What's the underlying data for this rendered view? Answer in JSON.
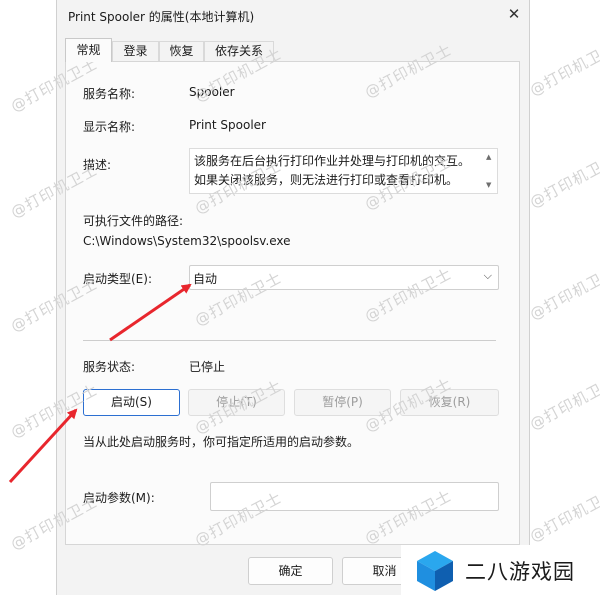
{
  "window": {
    "title": "Print Spooler 的属性(本地计算机)",
    "close_glyph": "✕"
  },
  "tabs": [
    {
      "label": "常规",
      "active": true
    },
    {
      "label": "登录",
      "active": false
    },
    {
      "label": "恢复",
      "active": false
    },
    {
      "label": "依存关系",
      "active": false
    }
  ],
  "general": {
    "service_name_label": "服务名称:",
    "service_name": "Spooler",
    "display_name_label": "显示名称:",
    "display_name": "Print Spooler",
    "description_label": "描述:",
    "description": "该服务在后台执行打印作业并处理与打印机的交互。如果关闭该服务，则无法进行打印或查看打印机。",
    "path_label": "可执行文件的路径:",
    "path": "C:\\Windows\\System32\\spoolsv.exe",
    "startup_type_label": "启动类型(E):",
    "startup_type": "自动",
    "status_label": "服务状态:",
    "status": "已停止",
    "buttons": {
      "start": "启动(S)",
      "stop": "停止(T)",
      "pause": "暂停(P)",
      "resume": "恢复(R)"
    },
    "hint": "当从此处启动服务时，你可指定所适用的启动参数。",
    "params_label": "启动参数(M):",
    "params_value": ""
  },
  "footer": {
    "ok": "确定",
    "cancel": "取消"
  },
  "watermark_text": "@打印机卫士",
  "brand": {
    "name": "二八游戏园"
  },
  "colors": {
    "accent_border": "#2c6fd1",
    "annotation_arrow": "#e8262d",
    "brand_blue": "#1f8fe0",
    "brand_dark": "#0f5fb0"
  }
}
